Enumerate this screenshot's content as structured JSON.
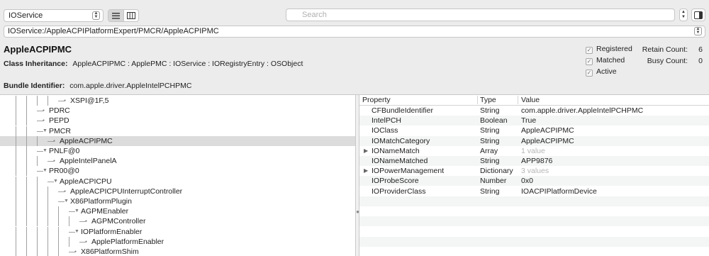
{
  "toolbar": {
    "plane_select": "IOService",
    "search_placeholder": "Search",
    "search_glyph": "⌕"
  },
  "path_bar": {
    "value": "IOService:/AppleACPIPlatformExpert/PMCR/AppleACPIPMC"
  },
  "info": {
    "class_name": "AppleACPIPMC",
    "inheritance_label": "Class Inheritance:",
    "inheritance_value": "AppleACPIPMC : ApplePMC : IOService : IORegistryEntry : OSObject",
    "bundle_label": "Bundle Identifier:",
    "bundle_value": "com.apple.driver.AppleIntelPCHPMC",
    "checkboxes": [
      {
        "label": "Registered",
        "checked": true
      },
      {
        "label": "Matched",
        "checked": true
      },
      {
        "label": "Active",
        "checked": true
      }
    ],
    "retain_label": "Retain Count:",
    "retain_value": "6",
    "busy_label": "Busy Count:",
    "busy_value": "0"
  },
  "tree": [
    {
      "label": "XSPI@1F,5",
      "indent": 5,
      "expander": "none",
      "selected": false
    },
    {
      "label": "PDRC",
      "indent": 3,
      "expander": "none",
      "selected": false
    },
    {
      "label": "PEPD",
      "indent": 3,
      "expander": "none",
      "selected": false
    },
    {
      "label": "PMCR",
      "indent": 3,
      "expander": "open",
      "selected": false
    },
    {
      "label": "AppleACPIPMC",
      "indent": 4,
      "expander": "none",
      "selected": true
    },
    {
      "label": "PNLF@0",
      "indent": 3,
      "expander": "open",
      "selected": false
    },
    {
      "label": "AppleIntelPanelA",
      "indent": 4,
      "expander": "none",
      "selected": false
    },
    {
      "label": "PR00@0",
      "indent": 3,
      "expander": "open",
      "selected": false
    },
    {
      "label": "AppleACPICPU",
      "indent": 4,
      "expander": "open",
      "selected": false
    },
    {
      "label": "AppleACPICPUInterruptController",
      "indent": 5,
      "expander": "none",
      "selected": false
    },
    {
      "label": "X86PlatformPlugin",
      "indent": 5,
      "expander": "open",
      "selected": false
    },
    {
      "label": "AGPMEnabler",
      "indent": 6,
      "expander": "open",
      "selected": false
    },
    {
      "label": "AGPMController",
      "indent": 7,
      "expander": "none",
      "selected": false
    },
    {
      "label": "IOPlatformEnabler",
      "indent": 6,
      "expander": "open",
      "selected": false
    },
    {
      "label": "ApplePlatformEnabler",
      "indent": 7,
      "expander": "none",
      "selected": false
    },
    {
      "label": "X86PlatformShim",
      "indent": 6,
      "expander": "none",
      "selected": false
    }
  ],
  "properties": {
    "headers": {
      "property": "Property",
      "type": "Type",
      "value": "Value"
    },
    "rows": [
      {
        "key": "CFBundleIdentifier",
        "type": "String",
        "value": "com.apple.driver.AppleIntelPCHPMC",
        "expandable": false,
        "muted": false
      },
      {
        "key": "IntelPCH",
        "type": "Boolean",
        "value": "True",
        "expandable": false,
        "muted": false
      },
      {
        "key": "IOClass",
        "type": "String",
        "value": "AppleACPIPMC",
        "expandable": false,
        "muted": false
      },
      {
        "key": "IOMatchCategory",
        "type": "String",
        "value": "AppleACPIPMC",
        "expandable": false,
        "muted": false
      },
      {
        "key": "IONameMatch",
        "type": "Array",
        "value": "1 value",
        "expandable": true,
        "muted": true
      },
      {
        "key": "IONameMatched",
        "type": "String",
        "value": "APP9876",
        "expandable": false,
        "muted": false
      },
      {
        "key": "IOPowerManagement",
        "type": "Dictionary",
        "value": "3 values",
        "expandable": true,
        "muted": true
      },
      {
        "key": "IOProbeScore",
        "type": "Number",
        "value": "0x0",
        "expandable": false,
        "muted": false
      },
      {
        "key": "IOProviderClass",
        "type": "String",
        "value": "IOACPIPlatformDevice",
        "expandable": false,
        "muted": false
      }
    ]
  },
  "icons": {
    "list_view": "list-icon",
    "column_view": "columns-icon",
    "search": "search-icon",
    "inspector": "inspector-icon",
    "disclosure_open": "▼",
    "disclosure_closed": "▶",
    "checkmark": "✓"
  },
  "colors": {
    "selection": "#dcdcdc",
    "alt_row": "#f4f5f5",
    "chrome": "#ececec"
  }
}
